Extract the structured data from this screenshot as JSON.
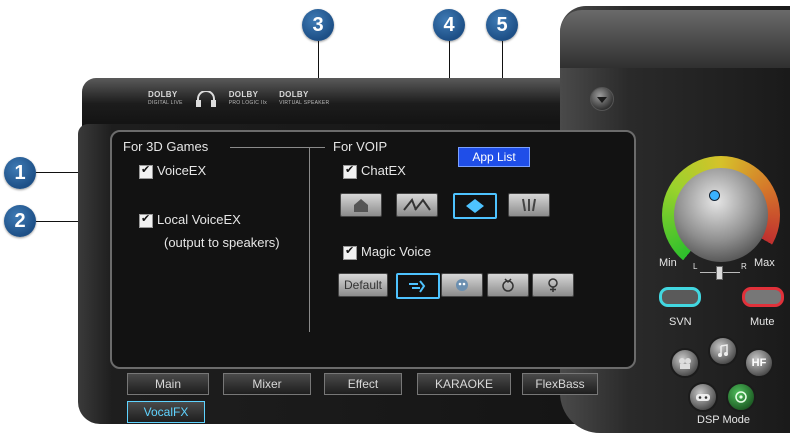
{
  "callouts": [
    "1",
    "2",
    "3",
    "4",
    "5"
  ],
  "header": {
    "dolby_logos": [
      {
        "name": "DOLBY",
        "sub": "DIGITAL LIVE"
      },
      {
        "name": "DOLBY",
        "sub": "PRO LOGIC IIx"
      },
      {
        "name": "DOLBY",
        "sub": "VIRTUAL SPEAKER"
      }
    ],
    "menu_icon": "chevron-down-icon"
  },
  "games": {
    "heading": "For 3D Games",
    "voiceex": "VoiceEX",
    "local_voiceex": "Local VoiceEX",
    "local_note": "(output to speakers)"
  },
  "voip": {
    "heading": "For VOIP",
    "chatex": "ChatEX",
    "app_list": "App List",
    "magic_voice": "Magic Voice",
    "default_button": "Default",
    "chatex_icons": [
      "house-icon",
      "road-icon",
      "wave-icon",
      "forest-icon"
    ],
    "magic_icons": [
      "runner-icon",
      "alien-face-icon",
      "male-icon",
      "female-icon"
    ]
  },
  "tabs": [
    "Main",
    "Mixer",
    "Effect",
    "KARAOKE",
    "FlexBass",
    "VocalFX"
  ],
  "volume": {
    "min": "Min",
    "max": "Max",
    "left": "L",
    "right": "R"
  },
  "controls": {
    "svn": "SVN",
    "mute": "Mute",
    "dsp_mode": "DSP Mode",
    "hf": "HF"
  },
  "colors": {
    "accent": "#4ec3ff",
    "applist_bg": "#1f4ee8",
    "svn": "#42d7e0",
    "mute": "#e0313a"
  }
}
